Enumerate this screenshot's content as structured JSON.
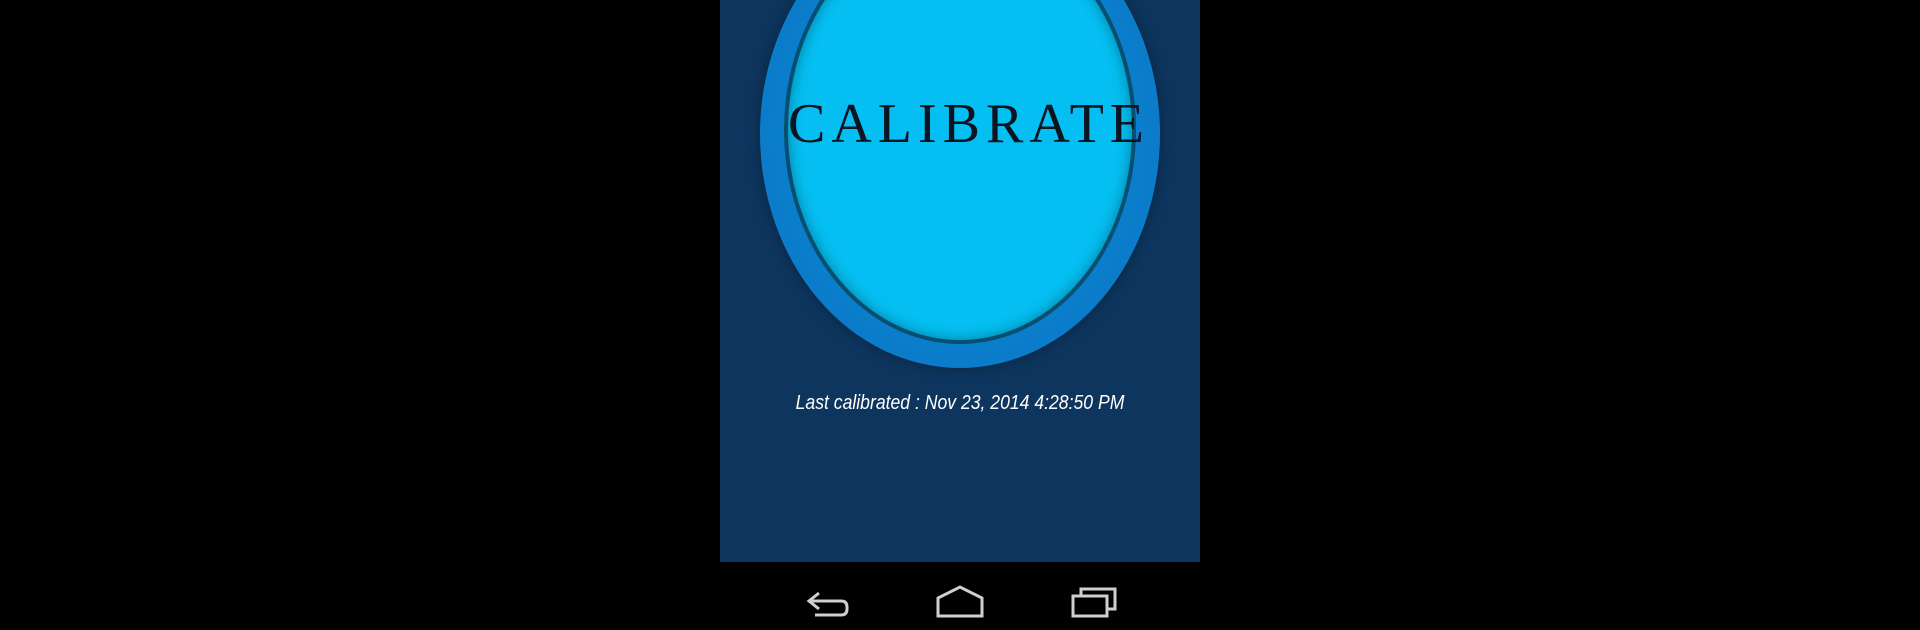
{
  "calibrate_button": {
    "label": "CALIBRATE"
  },
  "status": {
    "last_calibrated": "Last calibrated : Nov 23, 2014 4:28:50 PM"
  },
  "navbar": {
    "icons": [
      "back-icon",
      "home-icon",
      "recents-icon"
    ]
  },
  "colors": {
    "screen_background": "#0d355e",
    "button_outer": "#0a7ac8",
    "button_inner": "#05bff2",
    "button_text": "#0b1420",
    "status_text": "#ffffff",
    "outer_background": "#000000"
  }
}
